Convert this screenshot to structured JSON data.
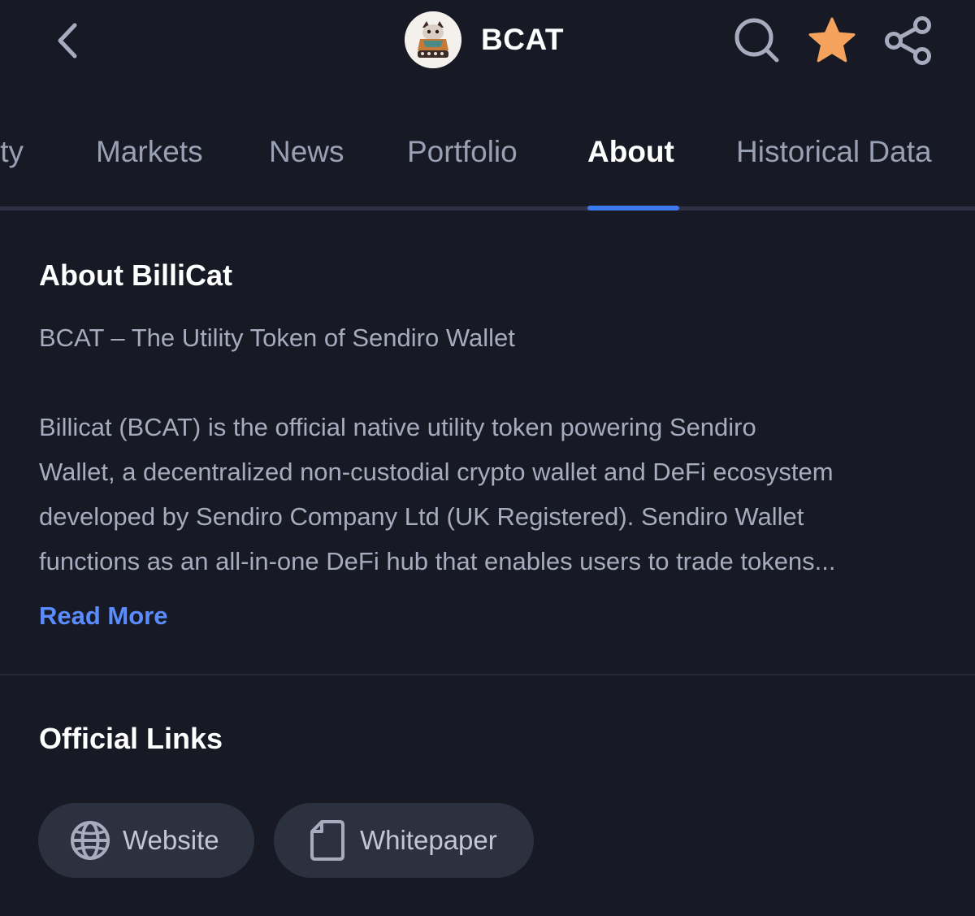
{
  "header": {
    "title": "BCAT",
    "icons": {
      "back": "chevron-left-icon",
      "search": "search-icon",
      "favorite": "star-icon",
      "share": "share-icon"
    },
    "favorite_color": "#f5a25d"
  },
  "tabs": {
    "items": [
      {
        "label": "ity"
      },
      {
        "label": "Markets"
      },
      {
        "label": "News"
      },
      {
        "label": "Portfolio"
      },
      {
        "label": "About"
      },
      {
        "label": "Historical Data"
      }
    ],
    "active": "About",
    "accent": "#3c78f0"
  },
  "about": {
    "title": "About BilliCat",
    "subtitle": "BCAT – The Utility Token of Sendiro Wallet",
    "body_lines": [
      "Billicat (BCAT) is the official native utility token powering Sendiro",
      "Wallet, a decentralized non-custodial crypto wallet and DeFi ecosystem",
      "developed by Sendiro Company Ltd (UK Registered). Sendiro Wallet",
      "functions as an all-in-one DeFi hub that enables users to trade tokens..."
    ],
    "read_more": "Read More"
  },
  "links": {
    "title": "Official Links",
    "items": [
      {
        "label": "Website",
        "icon": "globe-icon"
      },
      {
        "label": "Whitepaper",
        "icon": "document-icon"
      }
    ]
  }
}
